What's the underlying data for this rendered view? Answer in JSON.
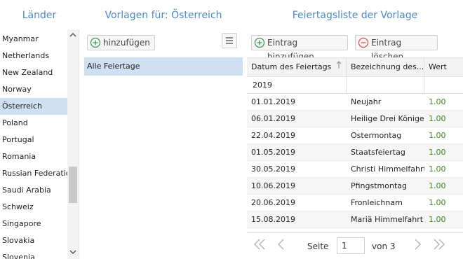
{
  "headers": {
    "countries": "Länder",
    "templates": "Vorlagen für: Österreich",
    "holidays": "Feiertagsliste der Vorlage"
  },
  "countries": {
    "items": [
      "Myanmar",
      "Netherlands",
      "New Zealand",
      "Norway",
      "Österreich",
      "Poland",
      "Portugal",
      "Romania",
      "Russian Federation",
      "Saudi Arabia",
      "Schweiz",
      "Singapore",
      "Slovakia",
      "Slovenia"
    ],
    "selected": "Österreich"
  },
  "templates": {
    "add_label": "hinzufügen",
    "items": [
      "Alle Feiertage"
    ]
  },
  "holidays": {
    "add_label": "Eintrag hinzufügen",
    "delete_label": "Eintrag löschen",
    "columns": {
      "date": "Datum des Feiertags",
      "name": "Bezeichnung des...",
      "value": "Wert"
    },
    "filter_year": "2019",
    "rows": [
      {
        "date": "01.01.2019",
        "name": "Neujahr",
        "value": "1.00"
      },
      {
        "date": "06.01.2019",
        "name": "Heilige Drei Könige",
        "value": "1.00"
      },
      {
        "date": "22.04.2019",
        "name": "Ostermontag",
        "value": "1.00"
      },
      {
        "date": "01.05.2019",
        "name": "Staatsfeiertag",
        "value": "1.00"
      },
      {
        "date": "30.05.2019",
        "name": "Christi Himmelfahrt",
        "value": "1.00"
      },
      {
        "date": "10.06.2019",
        "name": "Pfingstmontag",
        "value": "1.00"
      },
      {
        "date": "20.06.2019",
        "name": "Fronleichnam",
        "value": "1.00"
      },
      {
        "date": "15.08.2019",
        "name": "Mariä Himmelfahrt",
        "value": "1.00"
      }
    ],
    "pager": {
      "page_label": "Seite",
      "page_value": "1",
      "of_label": "von 3"
    }
  },
  "colors": {
    "header_blue": "#4a88c6",
    "selection": "#cfe0f3",
    "add_green": "#3a9a5a",
    "delete_red": "#d9534f",
    "value_green": "#3a8a1e"
  }
}
